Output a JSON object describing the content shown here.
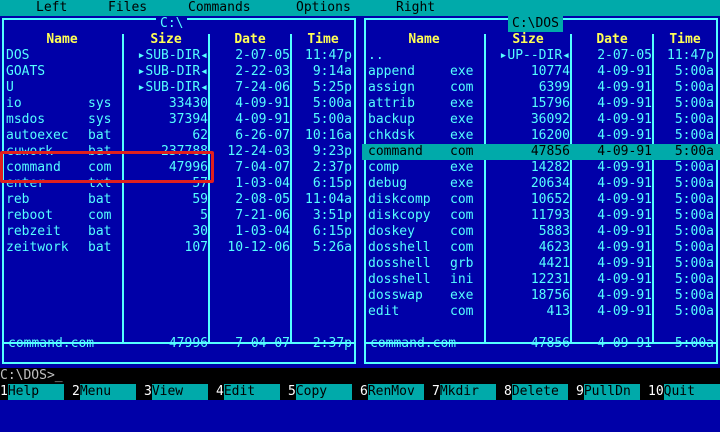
{
  "menu": [
    "Left",
    "Files",
    "Commands",
    "Options",
    "Right"
  ],
  "left_panel": {
    "title": "C:\\",
    "headers": {
      "name": "Name",
      "size": "Size",
      "date": "Date",
      "time": "Time"
    },
    "rows": [
      {
        "name": "DOS",
        "ext": "",
        "size": "▸SUB-DIR◂",
        "date": "2-07-05",
        "time": "11:47p"
      },
      {
        "name": "GOATS",
        "ext": "",
        "size": "▸SUB-DIR◂",
        "date": "2-22-03",
        "time": "9:14a"
      },
      {
        "name": "U",
        "ext": "",
        "size": "▸SUB-DIR◂",
        "date": "7-24-06",
        "time": "5:25p"
      },
      {
        "name": "io",
        "ext": "sys",
        "size": "33430",
        "date": "4-09-91",
        "time": "5:00a"
      },
      {
        "name": "msdos",
        "ext": "sys",
        "size": "37394",
        "date": "4-09-91",
        "time": "5:00a"
      },
      {
        "name": "autoexec",
        "ext": "bat",
        "size": "62",
        "date": "6-26-07",
        "time": "10:16a"
      },
      {
        "name": "cuwork",
        "ext": "bat",
        "size": "237788",
        "date": "12-24-03",
        "time": "9:23p"
      },
      {
        "name": "command",
        "ext": "com",
        "size": "47996",
        "date": "7-04-07",
        "time": "2:37p"
      },
      {
        "name": "enter",
        "ext": "txt",
        "size": "57",
        "date": "1-03-04",
        "time": "6:15p"
      },
      {
        "name": "reb",
        "ext": "bat",
        "size": "59",
        "date": "2-08-05",
        "time": "11:04a"
      },
      {
        "name": "reboot",
        "ext": "com",
        "size": "5",
        "date": "7-21-06",
        "time": "3:51p"
      },
      {
        "name": "rebzeit",
        "ext": "bat",
        "size": "30",
        "date": "1-03-04",
        "time": "6:15p"
      },
      {
        "name": "zeitwork",
        "ext": "bat",
        "size": "107",
        "date": "10-12-06",
        "time": "5:26a"
      }
    ],
    "info": {
      "name": "command.com",
      "size": "47996",
      "date": "7-04-07",
      "time": "2:37p"
    }
  },
  "right_panel": {
    "title": "C:\\DOS",
    "headers": {
      "name": "Name",
      "size": "Size",
      "date": "Date",
      "time": "Time"
    },
    "rows": [
      {
        "name": "..",
        "ext": "",
        "size": "▸UP--DIR◂",
        "date": "2-07-05",
        "time": "11:47p"
      },
      {
        "name": "append",
        "ext": "exe",
        "size": "10774",
        "date": "4-09-91",
        "time": "5:00a"
      },
      {
        "name": "assign",
        "ext": "com",
        "size": "6399",
        "date": "4-09-91",
        "time": "5:00a"
      },
      {
        "name": "attrib",
        "ext": "exe",
        "size": "15796",
        "date": "4-09-91",
        "time": "5:00a"
      },
      {
        "name": "backup",
        "ext": "exe",
        "size": "36092",
        "date": "4-09-91",
        "time": "5:00a"
      },
      {
        "name": "chkdsk",
        "ext": "exe",
        "size": "16200",
        "date": "4-09-91",
        "time": "5:00a"
      },
      {
        "name": "command",
        "ext": "com",
        "size": "47856",
        "date": "4-09-91",
        "time": "5:00a",
        "selected": true
      },
      {
        "name": "comp",
        "ext": "exe",
        "size": "14282",
        "date": "4-09-91",
        "time": "5:00a"
      },
      {
        "name": "debug",
        "ext": "exe",
        "size": "20634",
        "date": "4-09-91",
        "time": "5:00a"
      },
      {
        "name": "diskcomp",
        "ext": "com",
        "size": "10652",
        "date": "4-09-91",
        "time": "5:00a"
      },
      {
        "name": "diskcopy",
        "ext": "com",
        "size": "11793",
        "date": "4-09-91",
        "time": "5:00a"
      },
      {
        "name": "doskey",
        "ext": "com",
        "size": "5883",
        "date": "4-09-91",
        "time": "5:00a"
      },
      {
        "name": "dosshell",
        "ext": "com",
        "size": "4623",
        "date": "4-09-91",
        "time": "5:00a"
      },
      {
        "name": "dosshell",
        "ext": "grb",
        "size": "4421",
        "date": "4-09-91",
        "time": "5:00a"
      },
      {
        "name": "dosshell",
        "ext": "ini",
        "size": "12231",
        "date": "4-09-91",
        "time": "5:00a"
      },
      {
        "name": "dosswap",
        "ext": "exe",
        "size": "18756",
        "date": "4-09-91",
        "time": "5:00a"
      },
      {
        "name": "edit",
        "ext": "com",
        "size": "413",
        "date": "4-09-91",
        "time": "5:00a"
      }
    ],
    "info": {
      "name": "command.com",
      "size": "47856",
      "date": "4-09-91",
      "time": "5:00a"
    }
  },
  "command_line": "C:\\DOS>_",
  "function_keys": [
    {
      "num": "1",
      "label": "Help"
    },
    {
      "num": "2",
      "label": "Menu"
    },
    {
      "num": "3",
      "label": "View"
    },
    {
      "num": "4",
      "label": "Edit"
    },
    {
      "num": "5",
      "label": "Copy"
    },
    {
      "num": "6",
      "label": "RenMov"
    },
    {
      "num": "7",
      "label": "Mkdir"
    },
    {
      "num": "8",
      "label": "Delete"
    },
    {
      "num": "9",
      "label": "PullDn"
    },
    {
      "num": "10",
      "label": "Quit"
    }
  ],
  "colors": {
    "panel_bg": "#0000a8",
    "text": "#55ffff",
    "header": "#ffff55",
    "selection": "#00aaaa",
    "highlight_box": "#e0201e"
  }
}
